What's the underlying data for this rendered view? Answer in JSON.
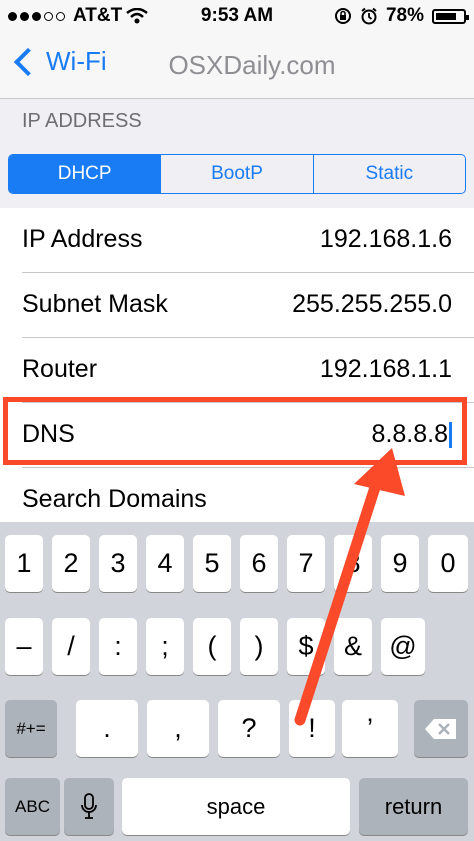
{
  "status_bar": {
    "carrier": "AT&T",
    "time": "9:53 AM",
    "battery": "78%",
    "battery_level": 0.78
  },
  "nav": {
    "back_label": "Wi-Fi",
    "title": "OSXDaily.com"
  },
  "section_header": "IP ADDRESS",
  "segments": [
    "DHCP",
    "BootP",
    "Static"
  ],
  "selected_segment": "DHCP",
  "rows": [
    {
      "label": "IP Address",
      "value": "192.168.1.6"
    },
    {
      "label": "Subnet Mask",
      "value": "255.255.255.0"
    },
    {
      "label": "Router",
      "value": "192.168.1.1"
    },
    {
      "label": "DNS",
      "value": "8.8.8.8"
    },
    {
      "label": "Search Domains",
      "value": ""
    }
  ],
  "keyboard": {
    "row1": [
      "1",
      "2",
      "3",
      "4",
      "5",
      "6",
      "7",
      "8",
      "9",
      "0"
    ],
    "row2": [
      "–",
      "/",
      ":",
      ";",
      "(",
      ")",
      "$",
      "&",
      "@"
    ],
    "row3_left": "#+=",
    "row3": [
      ".",
      ",",
      "?",
      "!",
      "’"
    ],
    "abc": "ABC",
    "space": "space",
    "return": "return",
    "icons": [
      "microphone-icon",
      "delete-icon"
    ]
  },
  "colors": {
    "accent": "#1a7cf4",
    "highlight": "#fb4a2a"
  }
}
